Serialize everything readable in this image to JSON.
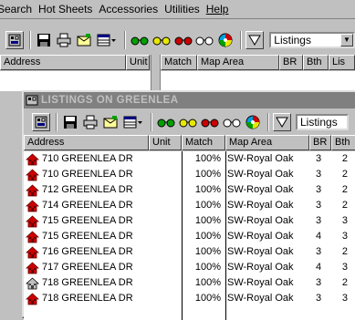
{
  "menu": [
    "Search",
    "Hot Sheets",
    "Accessories",
    "Utilities",
    "Help"
  ],
  "toolbar": {
    "combo_value": "Listings"
  },
  "back_columns": [
    "Address",
    "Unit",
    "Match",
    "Map Area",
    "BR",
    "Bth",
    "Lis"
  ],
  "window": {
    "title": "LISTINGS ON GREENLEA",
    "combo_value": "Listings",
    "columns": [
      "Address",
      "Unit",
      "Match",
      "Map Area",
      "BR",
      "Bth"
    ],
    "rows": [
      {
        "address": "710 GREENLEA DR",
        "unit": "",
        "match": "100%",
        "area": "SW-Royal Oak",
        "br": "3",
        "bth": "2",
        "icon": "house-red-icon"
      },
      {
        "address": "710 GREENLEA DR",
        "unit": "",
        "match": "100%",
        "area": "SW-Royal Oak",
        "br": "3",
        "bth": "2",
        "icon": "house-red-icon"
      },
      {
        "address": "712 GREENLEA DR",
        "unit": "",
        "match": "100%",
        "area": "SW-Royal Oak",
        "br": "3",
        "bth": "2",
        "icon": "house-red-icon"
      },
      {
        "address": "714 GREENLEA DR",
        "unit": "",
        "match": "100%",
        "area": "SW-Royal Oak",
        "br": "3",
        "bth": "2",
        "icon": "house-red-icon"
      },
      {
        "address": "715 GREENLEA DR",
        "unit": "",
        "match": "100%",
        "area": "SW-Royal Oak",
        "br": "3",
        "bth": "3",
        "icon": "house-red-icon"
      },
      {
        "address": "715 GREENLEA DR",
        "unit": "",
        "match": "100%",
        "area": "SW-Royal Oak",
        "br": "4",
        "bth": "3",
        "icon": "house-red-icon"
      },
      {
        "address": "716 GREENLEA DR",
        "unit": "",
        "match": "100%",
        "area": "SW-Royal Oak",
        "br": "3",
        "bth": "2",
        "icon": "house-red-icon"
      },
      {
        "address": "717 GREENLEA DR",
        "unit": "",
        "match": "100%",
        "area": "SW-Royal Oak",
        "br": "4",
        "bth": "3",
        "icon": "house-red-icon"
      },
      {
        "address": "718 GREENLEA DR",
        "unit": "",
        "match": "100%",
        "area": "SW-Royal Oak",
        "br": "3",
        "bth": "2",
        "icon": "house-gray-icon"
      },
      {
        "address": "718 GREENLEA DR",
        "unit": "",
        "match": "100%",
        "area": "SW-Royal Oak",
        "br": "3",
        "bth": "3",
        "icon": "house-red-icon"
      }
    ]
  },
  "colors": {
    "house_red": "#cc0000",
    "title_inactive": "#808080"
  }
}
